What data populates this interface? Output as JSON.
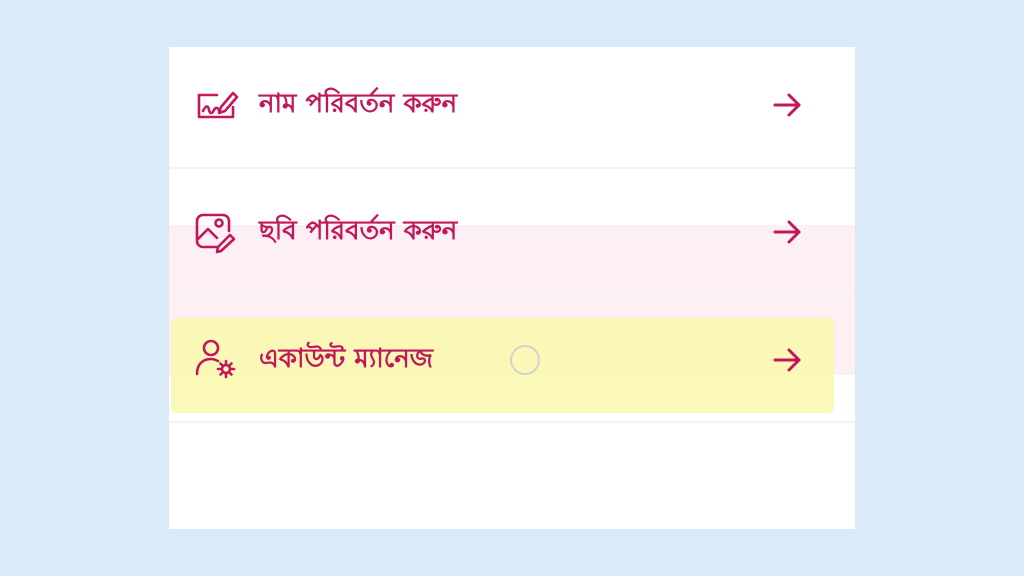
{
  "menu": {
    "items": [
      {
        "label": "নাম পরিবর্তন করুন",
        "icon": "edit-name-icon"
      },
      {
        "label": "ছবি পরিবর্তন করুন",
        "icon": "edit-photo-icon"
      },
      {
        "label": "একাউন্ট ম্যানেজ",
        "icon": "account-settings-icon"
      }
    ],
    "arrow_icon": "arrow-right-icon",
    "highlighted_index": 2
  },
  "colors": {
    "accent": "#c2185b",
    "background": "#dbeaf9",
    "panel": "#ffffff",
    "highlight": "#fbf8b0",
    "pink_band": "#fdf0f4"
  }
}
